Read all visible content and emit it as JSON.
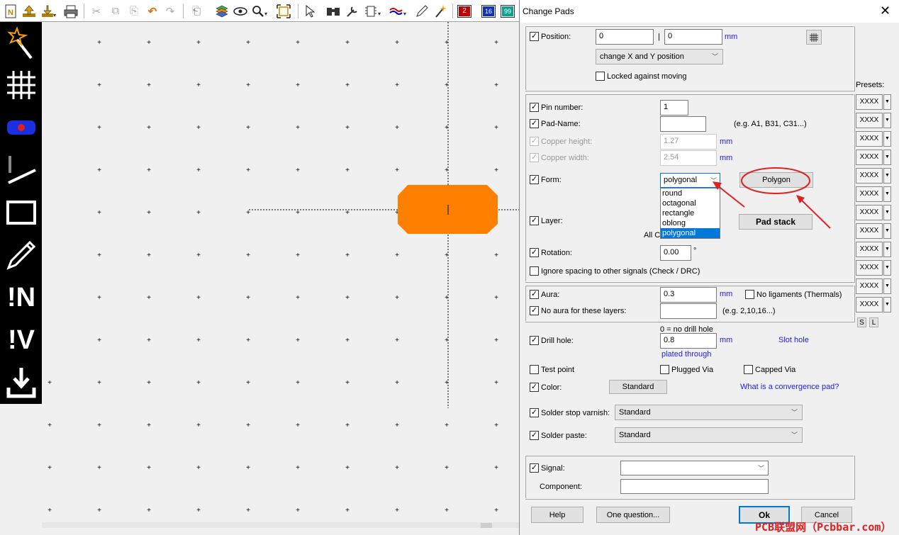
{
  "toolbar": {
    "icons": [
      "new-file-icon",
      "export-icon",
      "import-icon",
      "print-icon",
      "cut-icon",
      "copy-icon",
      "paste-icon",
      "undo-icon",
      "redo-icon",
      "macro-icon",
      "layers-icon",
      "view-icon",
      "zoom-icon",
      "zoom-fit-icon",
      "select-icon",
      "find-icon",
      "properties-icon",
      "drc-icon",
      "route-icon",
      "pen-icon",
      "autoroute-icon"
    ],
    "badge1": "2",
    "badge2": "16",
    "badge3": "99"
  },
  "left_tools": {
    "text_n": "!N",
    "text_v": "!V"
  },
  "dialog": {
    "title": "Change Pads",
    "position": {
      "label": "Position:",
      "x": "0",
      "separator": "|",
      "y": "0",
      "unit": "mm",
      "mode": "change X and Y position",
      "locked_label": "Locked against moving"
    },
    "presets_label": "Presets:",
    "presets": [
      "XXXX",
      "XXXX",
      "XXXX",
      "XXXX",
      "XXXX",
      "XXXX",
      "XXXX",
      "XXXX",
      "XXXX",
      "XXXX",
      "XXXX",
      "XXXX"
    ],
    "preset_s": "S",
    "preset_l": "L",
    "pin_number": {
      "label": "Pin number:",
      "value": "1"
    },
    "pad_name": {
      "label": "Pad-Name:",
      "value": "",
      "hint": "(e.g. A1, B31, C31...)"
    },
    "copper_height": {
      "label": "Copper height:",
      "value": "1.27",
      "unit": "mm"
    },
    "copper_width": {
      "label": "Copper width:",
      "value": "2.54",
      "unit": "mm"
    },
    "form": {
      "label": "Form:",
      "value": "polygonal",
      "options": [
        "round",
        "octagonal",
        "rectangle",
        "oblong",
        "polygonal"
      ],
      "polygon_button": "Polygon"
    },
    "layer": {
      "label": "Layer:",
      "sub": "All C",
      "padstack_button": "Pad stack"
    },
    "rotation": {
      "label": "Rotation:",
      "value": "0.00",
      "unit": "°"
    },
    "ignore_spacing": "Ignore spacing to other signals (Check / DRC)",
    "aura": {
      "label": "Aura:",
      "value": "0.3",
      "unit": "mm",
      "no_ligaments": "No ligaments (Thermals)"
    },
    "no_aura": {
      "label": "No aura for these layers:",
      "value": "",
      "hint": "(e.g. 2,10,16...)"
    },
    "drill": {
      "label": "Drill hole:",
      "hint": "0 = no drill hole",
      "value": "0.8",
      "unit": "mm",
      "slot": "Slot hole",
      "plated": "plated through"
    },
    "test_point": "Test point",
    "plugged_via": "Plugged Via",
    "capped_via": "Capped Via",
    "color": {
      "label": "Color:",
      "button": "Standard",
      "link": "What is a convergence pad?"
    },
    "solder_stop": {
      "label": "Solder stop varnish:",
      "value": "Standard"
    },
    "solder_paste": {
      "label": "Solder paste:",
      "value": "Standard"
    },
    "signal": {
      "label": "Signal:",
      "value": ""
    },
    "component": {
      "label": "Component:",
      "value": ""
    },
    "buttons": {
      "help": "Help",
      "question": "One question...",
      "ok": "Ok",
      "cancel": "Cancel"
    },
    "watermark": "PCB联盟网（Pcbbar.com）"
  },
  "colors": {
    "pad": "#ff8000",
    "annotation": "#e02020",
    "link": "#1a1aff"
  }
}
